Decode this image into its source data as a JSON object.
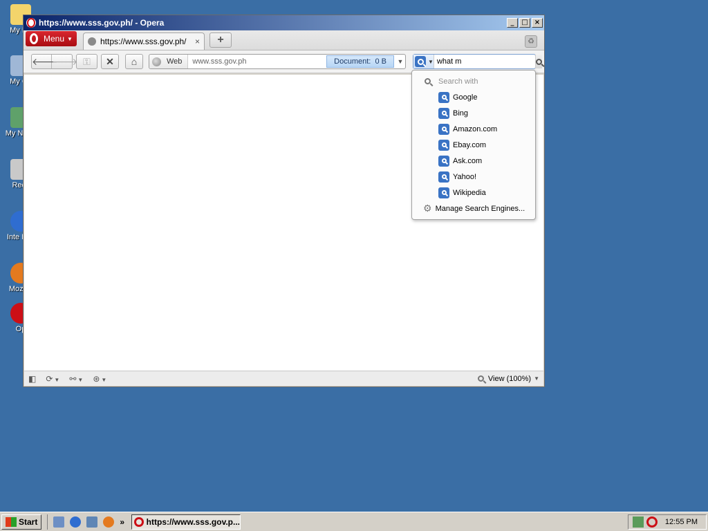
{
  "desktop": {
    "icons": [
      {
        "label": "My Do",
        "color": "#f3d46b"
      },
      {
        "label": "My Co",
        "color": "#9fb7d6"
      },
      {
        "label": "My N Pla",
        "color": "#5fa16a"
      },
      {
        "label": "Recy",
        "color": "#c9c9c9"
      },
      {
        "label": "Inte Exp",
        "color": "#2f6dd0"
      },
      {
        "label": "Mozilla",
        "color": "#e47a1f"
      },
      {
        "label": "Op",
        "color": "#cc0f16"
      }
    ]
  },
  "window": {
    "title": "https://www.sss.gov.ph/ - Opera",
    "controls": {
      "minimize": "_",
      "maximize": "□",
      "close": "×"
    }
  },
  "tabbar": {
    "menu_label": "Menu",
    "tab_title": "https://www.sss.gov.ph/",
    "tab_close": "×",
    "new_tab": "+",
    "trash_icon": "♻"
  },
  "navbar": {
    "back": "🡐",
    "forward": "🡒",
    "wand": "⚿",
    "stop": "✕",
    "home": "⌂",
    "web_label": "Web",
    "url": "www.sss.gov.ph",
    "document_label": "Document:",
    "document_size": "0 B",
    "dropdown_caret": "▼",
    "search_value": "what m"
  },
  "search_dropdown": {
    "header": "Search with",
    "engines": [
      {
        "name": "Google"
      },
      {
        "name": "Bing"
      },
      {
        "name": "Amazon.com"
      },
      {
        "name": "Ebay.com"
      },
      {
        "name": "Ask.com"
      },
      {
        "name": "Yahoo!"
      },
      {
        "name": "Wikipedia"
      }
    ],
    "manage_label": "Manage Search Engines..."
  },
  "statusbar": {
    "zoom_label": "View (100%)"
  },
  "taskbar": {
    "start_label": "Start",
    "task_label": "https://www.sss.gov.p...",
    "more": "»",
    "clock": "12:55 PM"
  },
  "colors": {
    "desktop": "#3a6ea5",
    "opera_red": "#cc0f16",
    "search_blue": "#3a73c4"
  }
}
